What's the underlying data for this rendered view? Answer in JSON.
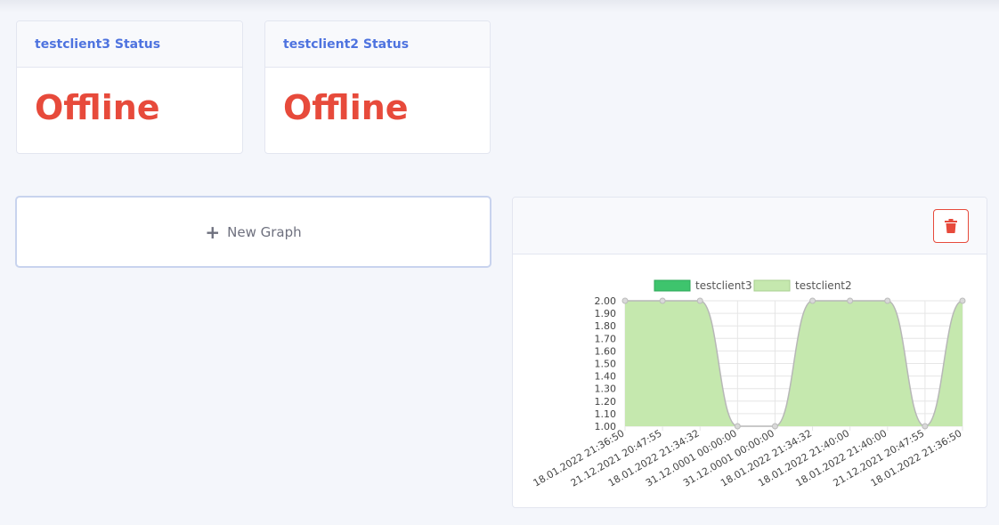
{
  "status_cards": [
    {
      "title": "testclient3 Status",
      "value": "Offline"
    },
    {
      "title": "testclient2 Status",
      "value": "Offline"
    }
  ],
  "new_graph": {
    "label": "New Graph",
    "icon": "plus-icon"
  },
  "graph_card": {
    "delete_icon": "trash-icon",
    "delete_color": "#e74a3b"
  },
  "colors": {
    "accent": "#4e73df",
    "danger": "#e74a3b",
    "series2_fill": "#c5e8ae",
    "series1_fill": "#3ec46d"
  },
  "chart_data": {
    "type": "area",
    "legend": [
      "testclient3",
      "testclient2"
    ],
    "series": [
      {
        "name": "testclient3",
        "values": []
      },
      {
        "name": "testclient2",
        "values": [
          2.0,
          2.0,
          2.0,
          1.0,
          1.0,
          2.0,
          2.0,
          2.0,
          1.0,
          2.0
        ]
      }
    ],
    "x": [
      "18.01.2022 21:36:50",
      "21.12.2021 20:47:55",
      "18.01.2022 21:34:32",
      "31.12.0001 00:00:00",
      "31.12.0001 00:00:00",
      "18.01.2022 21:34:32",
      "18.01.2022 21:40:00",
      "18.01.2022 21:40:00",
      "21.12.2021 20:47:55",
      "18.01.2022 21:36:50"
    ],
    "yticks": [
      "2.00",
      "1.90",
      "1.80",
      "1.70",
      "1.60",
      "1.50",
      "1.40",
      "1.30",
      "1.20",
      "1.10",
      "1.00"
    ],
    "ylim": [
      1.0,
      2.0
    ],
    "grid": true,
    "legend_position": "top"
  }
}
